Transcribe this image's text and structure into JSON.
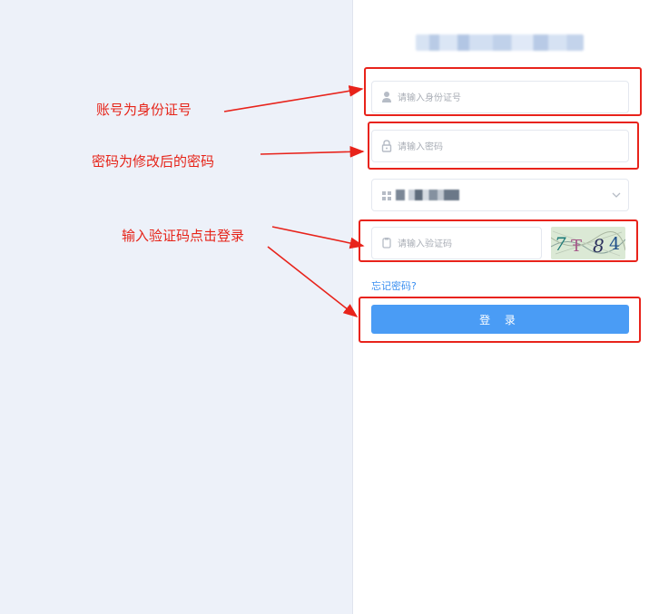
{
  "form": {
    "id_card_placeholder": "请输入身份证号",
    "password_placeholder": "请输入密码",
    "captcha_placeholder": "请输入验证码",
    "captcha_text": "7 8 4",
    "forgot_password": "忘记密码?",
    "login_button": "登 录"
  },
  "annotations": {
    "account_note": "账号为身份证号",
    "password_note": "密码为修改后的密码",
    "captcha_note": "输入验证码点击登录"
  },
  "colors": {
    "accent": "#4a9cf5",
    "annotation": "#e62419",
    "left_panel": "#edf1f9"
  },
  "icons": [
    "user-icon",
    "lock-icon",
    "grid-icon",
    "chevron-down-icon",
    "shield-icon"
  ]
}
